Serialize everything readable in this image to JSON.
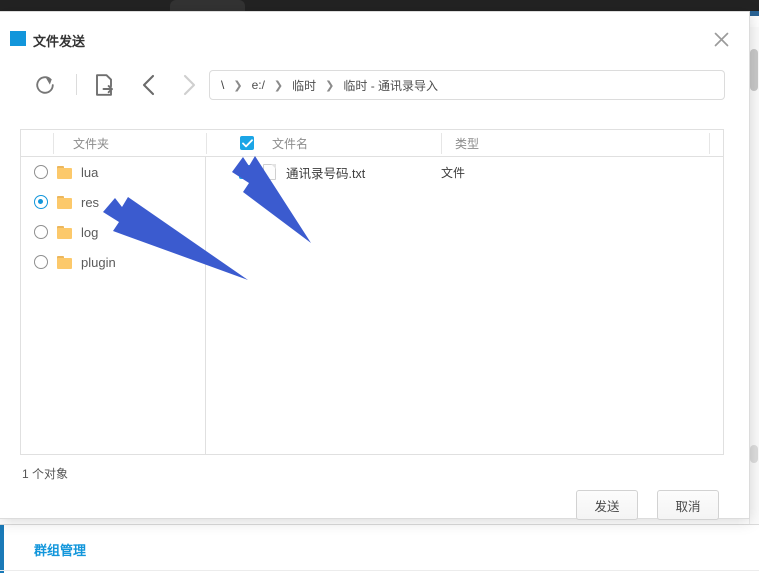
{
  "dialog": {
    "title": "文件发送",
    "close_icon": "close-icon"
  },
  "toolbar": {
    "refresh_icon": "refresh-icon",
    "export_icon": "file-export-icon",
    "back_icon": "chevron-left-icon",
    "forward_icon": "chevron-right-icon",
    "breadcrumb": [
      "\\",
      "e:/",
      "临时",
      "临时 - 通讯录导入"
    ],
    "separator": "❯"
  },
  "table": {
    "headers": {
      "folder": "文件夹",
      "filename": "文件名",
      "type": "类型"
    },
    "folders": [
      {
        "label": "lua",
        "selected": false
      },
      {
        "label": "res",
        "selected": true
      },
      {
        "label": "log",
        "selected": false
      },
      {
        "label": "plugin",
        "selected": false
      }
    ],
    "files": [
      {
        "name": "通讯录号码.txt",
        "type": "文件",
        "checked": true
      }
    ],
    "header_all_checked": true
  },
  "status": {
    "count_text": "1 个对象"
  },
  "actions": {
    "send_label": "发送",
    "cancel_label": "取消"
  },
  "background": {
    "bottom_section_label": "群组管理"
  },
  "colors": {
    "accent": "#1296db",
    "checkbox": "#1ba5e6",
    "folder": "#fcc96b",
    "arrow": "#3b5bcf",
    "bottom_label": "#1296db"
  }
}
